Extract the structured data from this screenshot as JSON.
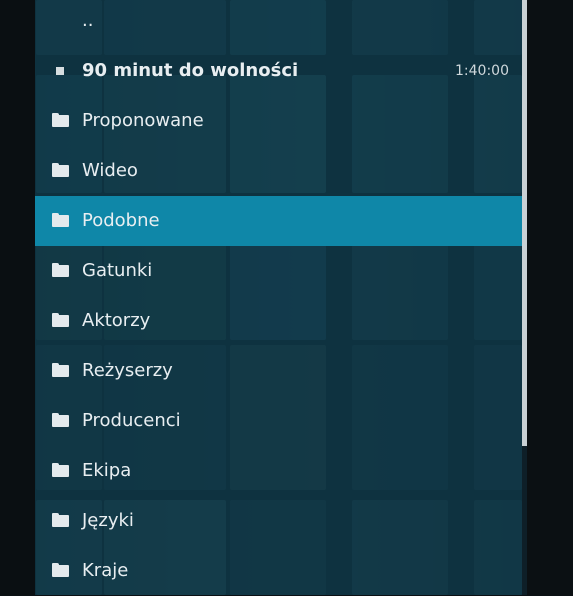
{
  "list": {
    "items": [
      {
        "label": "..",
        "icon": "parent-folder",
        "duration": ""
      },
      {
        "label": "90 minut do wolności",
        "icon": "video-file-icon",
        "duration": "1:40:00"
      },
      {
        "label": "Proponowane",
        "icon": "folder-icon",
        "duration": ""
      },
      {
        "label": "Wideo",
        "icon": "folder-icon",
        "duration": ""
      },
      {
        "label": "Podobne",
        "icon": "folder-icon",
        "duration": ""
      },
      {
        "label": "Gatunki",
        "icon": "folder-icon",
        "duration": ""
      },
      {
        "label": "Aktorzy",
        "icon": "folder-icon",
        "duration": ""
      },
      {
        "label": "Reżyserzy",
        "icon": "folder-icon",
        "duration": ""
      },
      {
        "label": "Producenci",
        "icon": "folder-icon",
        "duration": ""
      },
      {
        "label": "Ekipa",
        "icon": "folder-icon",
        "duration": ""
      },
      {
        "label": "Języki",
        "icon": "folder-icon",
        "duration": ""
      },
      {
        "label": "Kraje",
        "icon": "folder-icon",
        "duration": ""
      }
    ],
    "selected_index": 4
  },
  "colors": {
    "selection": "#0f87a8",
    "panel": "#103a4a"
  }
}
